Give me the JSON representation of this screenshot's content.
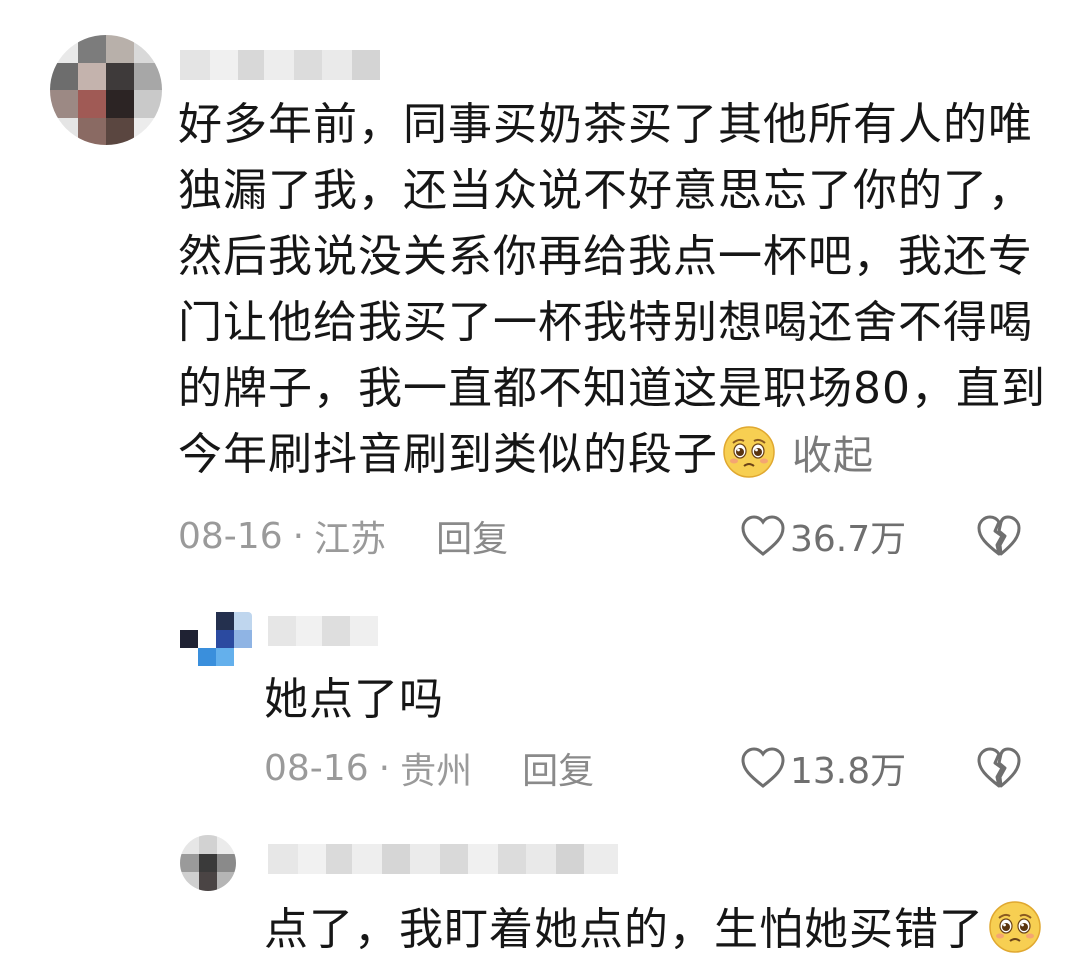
{
  "comments": [
    {
      "lines": [
        "好多年前，同事买奶茶买了其他所有人的唯",
        "独漏了我，还当众说不好意思忘了你的了，",
        "然后我说没关系你再给我点一杯吧，我还专",
        "门让他给我买了一杯我特别想喝还舍不得喝",
        "的牌子，我一直都不知道这是职场80，直到",
        "今年刷抖音刷到类似的段子"
      ],
      "emoji": "pleading-face-icon",
      "collapse_label": "收起",
      "date": "08-16",
      "separator": "·",
      "location": "江苏",
      "reply_label": "回复",
      "likes": "36.7万"
    },
    {
      "lines": [
        "她点了吗"
      ],
      "date": "08-16",
      "separator": "·",
      "location": "贵州",
      "reply_label": "回复",
      "likes": "13.8万"
    },
    {
      "lines": [
        "点了，我盯着她点的，生怕她买错了"
      ],
      "emoji": "pleading-face-icon"
    }
  ],
  "colors": {
    "text": "#161616",
    "meta": "#9a9a9a",
    "icon": "#6f6f6f"
  }
}
